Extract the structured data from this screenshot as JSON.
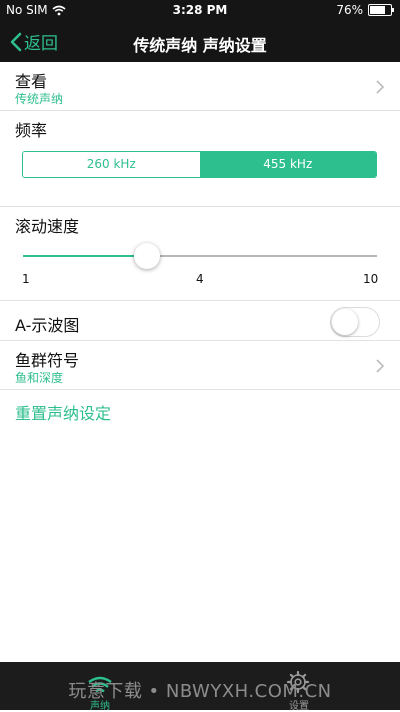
{
  "status_bar": {
    "carrier": "No SIM",
    "time": "3:28 PM",
    "battery": "76%",
    "battery_level": 0.76
  },
  "nav": {
    "back_label": "返回",
    "title": "传统声纳 声纳设置"
  },
  "view": {
    "title": "查看",
    "value": "传统声纳"
  },
  "frequency": {
    "title": "频率",
    "options": [
      "260 kHz",
      "455 kHz"
    ],
    "selected_index": 1
  },
  "scroll_speed": {
    "title": "滚动速度",
    "ticks": [
      "1",
      "4",
      "10"
    ],
    "value_fraction": 0.35
  },
  "a_scope": {
    "title": "A-示波图",
    "enabled": false
  },
  "fish_symbol": {
    "title": "鱼群符号",
    "value": "鱼和深度"
  },
  "reset": {
    "label": "重置声纳设定"
  },
  "tab_bar": {
    "tabs": [
      {
        "label": "声纳",
        "icon": "sonar-icon",
        "active": true
      },
      {
        "label": "设置",
        "icon": "gear-icon",
        "active": false
      }
    ]
  },
  "watermark": "玩意下载 • NBWYXH.COM.CN",
  "colors": {
    "accent": "#2ebf8e",
    "bar_background": "#151515",
    "tab_bar_background": "#1c1c1c"
  }
}
